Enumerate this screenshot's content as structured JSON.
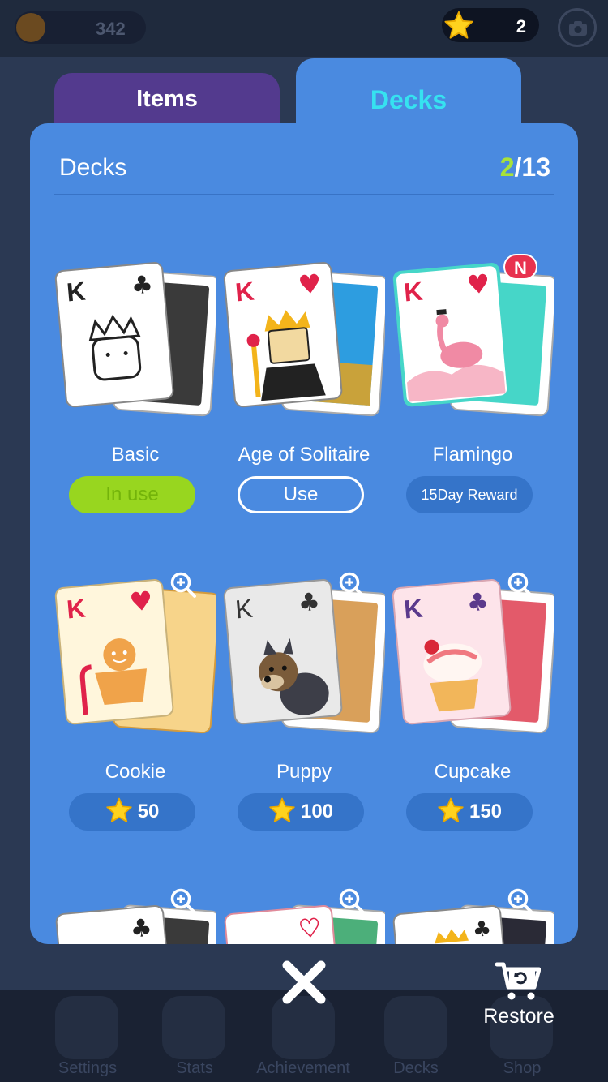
{
  "status_bar": {
    "coins": "342",
    "stars": "2"
  },
  "tabs": [
    {
      "label": "Items",
      "active": false
    },
    {
      "label": "Decks",
      "active": true
    }
  ],
  "panel": {
    "title": "Decks",
    "count_current": "2",
    "count_total": "/13"
  },
  "decks": [
    {
      "name": "Basic",
      "button": "In use",
      "state": "in-use"
    },
    {
      "name": "Age of Solitaire",
      "button": "Use",
      "state": "owned"
    },
    {
      "name": "Flamingo",
      "button": "15Day Reward",
      "state": "reward",
      "badge": "N"
    },
    {
      "name": "Cookie",
      "price": "50",
      "state": "buy"
    },
    {
      "name": "Puppy",
      "price": "100",
      "state": "buy"
    },
    {
      "name": "Cupcake",
      "price": "150",
      "state": "buy"
    }
  ],
  "bottom_nav": [
    "Settings",
    "Stats",
    "Achievement",
    "Decks",
    "Shop"
  ],
  "restore_label": "Restore",
  "colors": {
    "panel": "#4a8ae0",
    "items_tab": "#533a8e",
    "active_tab_text": "#36e2f0",
    "in_use_button": "#98d61f",
    "count_current": "#a8e23a",
    "badge": "#e8324f"
  },
  "icons": {
    "close": "close-icon",
    "restore": "cart-restore-icon",
    "zoom": "zoom-in-icon",
    "star": "star-icon"
  }
}
